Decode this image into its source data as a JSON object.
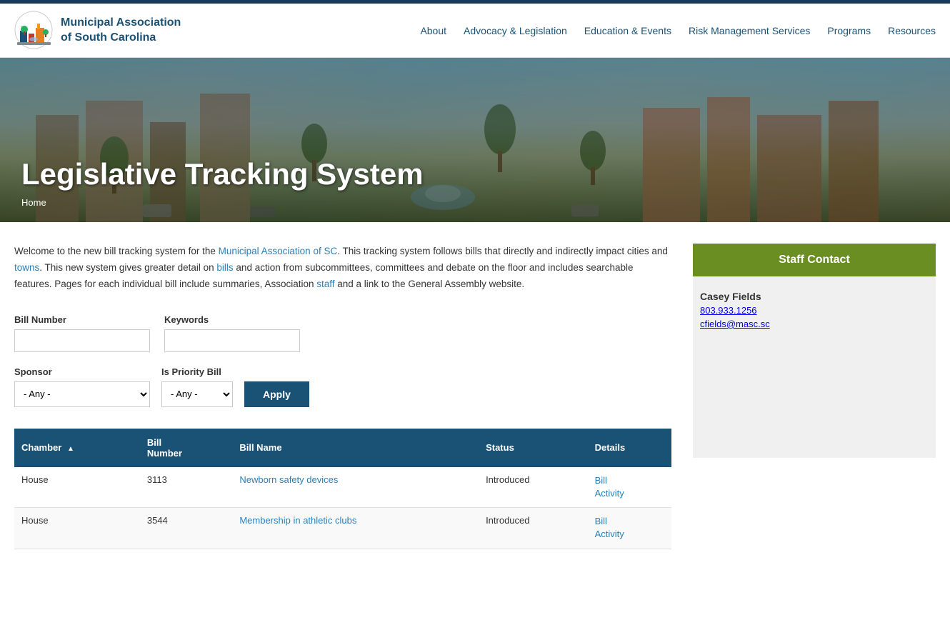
{
  "topbar": {},
  "header": {
    "logo_text_line1": "Municipal Association",
    "logo_text_line2": "of South Carolina",
    "nav_items": [
      {
        "label": "About",
        "id": "about"
      },
      {
        "label": "Advocacy & Legislation",
        "id": "advocacy"
      },
      {
        "label": "Education & Events",
        "id": "education"
      },
      {
        "label": "Risk Management Services",
        "id": "risk"
      },
      {
        "label": "Programs",
        "id": "programs"
      },
      {
        "label": "Resources",
        "id": "resources"
      }
    ]
  },
  "hero": {
    "title": "Legislative Tracking System",
    "breadcrumb_home": "Home"
  },
  "intro": {
    "text1": "Welcome to the new bill tracking system for the ",
    "link1": "Municipal Association of SC",
    "text2": ". This tracking system follows bills that directly and indirectly impact cities and towns. This new system gives greater detail on bills and action from subcommittees, committees and debate on the floor and includes searchable features. Pages for each individual bill include summaries, Association staff and a link to the General Assembly website."
  },
  "form": {
    "bill_number_label": "Bill Number",
    "bill_number_placeholder": "",
    "keywords_label": "Keywords",
    "keywords_placeholder": "",
    "sponsor_label": "Sponsor",
    "sponsor_default": "- Any -",
    "priority_label": "Is Priority Bill",
    "priority_default": "- Any -",
    "apply_label": "Apply"
  },
  "table": {
    "columns": [
      {
        "label": "Chamber",
        "sort": "▲",
        "id": "chamber"
      },
      {
        "label": "Bill\nNumber",
        "id": "bill_number"
      },
      {
        "label": "Bill Name",
        "id": "bill_name"
      },
      {
        "label": "Status",
        "id": "status"
      },
      {
        "label": "Details",
        "id": "details"
      }
    ],
    "rows": [
      {
        "chamber": "House",
        "bill_number": "3113",
        "bill_name": "Newborn safety devices",
        "status": "Introduced",
        "details_link1": "Bill",
        "details_link2": "Activity"
      },
      {
        "chamber": "House",
        "bill_number": "3544",
        "bill_name": "Membership in athletic clubs",
        "status": "Introduced",
        "details_link1": "Bill",
        "details_link2": "Activity"
      }
    ]
  },
  "sidebar": {
    "staff_contact_header": "Staff Contact",
    "staff_name": "Casey Fields",
    "staff_phone": "803.933.1256",
    "staff_email": "cfields@masc.sc"
  }
}
